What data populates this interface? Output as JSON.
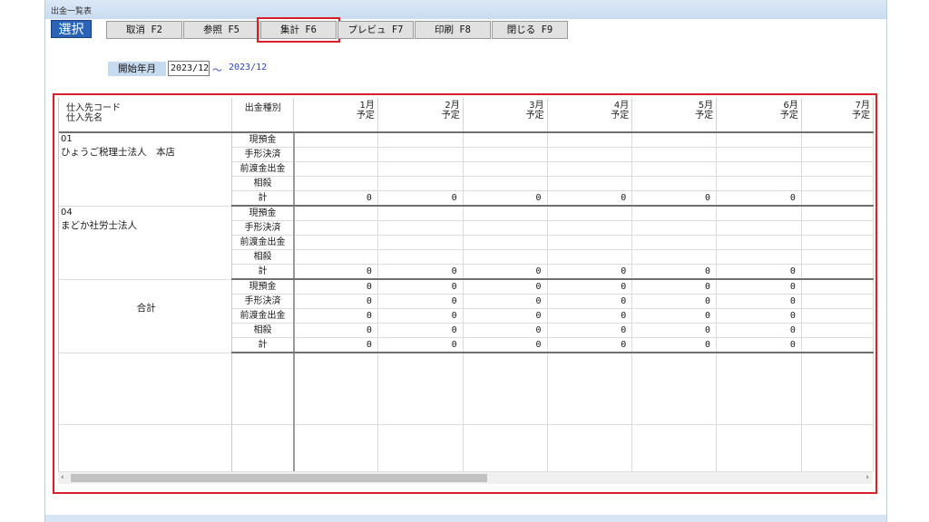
{
  "window": {
    "title": "出金一覧表"
  },
  "toolbar": {
    "select_label": "選択",
    "buttons": [
      {
        "label": "取消 F2",
        "highlighted": false
      },
      {
        "label": "参照 F5",
        "highlighted": false
      },
      {
        "label": "集計 F6",
        "highlighted": true
      },
      {
        "label": "プレビュ F7",
        "highlighted": false
      },
      {
        "label": "印刷 F8",
        "highlighted": false
      },
      {
        "label": "閉じる F9",
        "highlighted": false
      }
    ]
  },
  "period": {
    "label": "開始年月",
    "start_value": "2023/12",
    "separator": "～",
    "end_value": "2023/12"
  },
  "grid": {
    "header": {
      "supplier_code": "仕入先コード",
      "supplier_name": "仕入先名",
      "payment_type": "出金種別",
      "months": [
        {
          "month": "1月",
          "sub": "予定"
        },
        {
          "month": "2月",
          "sub": "予定"
        },
        {
          "month": "3月",
          "sub": "予定"
        },
        {
          "month": "4月",
          "sub": "予定"
        },
        {
          "month": "5月",
          "sub": "予定"
        },
        {
          "month": "6月",
          "sub": "予定"
        },
        {
          "month": "7月",
          "sub": "予定"
        }
      ]
    },
    "groups": [
      {
        "code": "01",
        "name": "ひょうご税理士法人　本店",
        "rows": [
          {
            "type": "現預金",
            "values": [
              "",
              "",
              "",
              "",
              "",
              "",
              ""
            ]
          },
          {
            "type": "手形決済",
            "values": [
              "",
              "",
              "",
              "",
              "",
              "",
              ""
            ]
          },
          {
            "type": "前渡金出金",
            "values": [
              "",
              "",
              "",
              "",
              "",
              "",
              ""
            ]
          },
          {
            "type": "相殺",
            "values": [
              "",
              "",
              "",
              "",
              "",
              "",
              ""
            ]
          },
          {
            "type": "計",
            "values": [
              "0",
              "0",
              "0",
              "0",
              "0",
              "0",
              ""
            ]
          }
        ]
      },
      {
        "code": "04",
        "name": "まどか社労士法人",
        "rows": [
          {
            "type": "現預金",
            "values": [
              "",
              "",
              "",
              "",
              "",
              "",
              ""
            ]
          },
          {
            "type": "手形決済",
            "values": [
              "",
              "",
              "",
              "",
              "",
              "",
              ""
            ]
          },
          {
            "type": "前渡金出金",
            "values": [
              "",
              "",
              "",
              "",
              "",
              "",
              ""
            ]
          },
          {
            "type": "相殺",
            "values": [
              "",
              "",
              "",
              "",
              "",
              "",
              ""
            ]
          },
          {
            "type": "計",
            "values": [
              "0",
              "0",
              "0",
              "0",
              "0",
              "0",
              ""
            ]
          }
        ]
      }
    ],
    "total": {
      "label": "合計",
      "rows": [
        {
          "type": "現預金",
          "values": [
            "0",
            "0",
            "0",
            "0",
            "0",
            "0",
            ""
          ]
        },
        {
          "type": "手形決済",
          "values": [
            "0",
            "0",
            "0",
            "0",
            "0",
            "0",
            ""
          ]
        },
        {
          "type": "前渡金出金",
          "values": [
            "0",
            "0",
            "0",
            "0",
            "0",
            "0",
            ""
          ]
        },
        {
          "type": "相殺",
          "values": [
            "0",
            "0",
            "0",
            "0",
            "0",
            "0",
            ""
          ]
        },
        {
          "type": "計",
          "values": [
            "0",
            "0",
            "0",
            "0",
            "0",
            "0",
            ""
          ]
        }
      ]
    }
  },
  "scrollbar": {
    "left_arrow": "‹",
    "right_arrow": "›"
  },
  "colors": {
    "select_bg": "#2b64b6",
    "highlight": "#d8202a",
    "label_bg": "#c7dbf0",
    "accent_text": "#2c48b8"
  }
}
